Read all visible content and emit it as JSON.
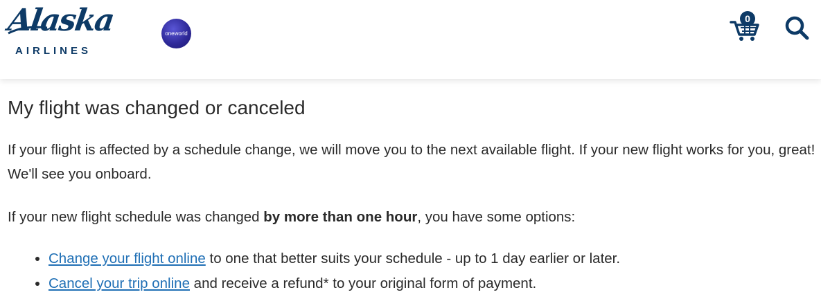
{
  "header": {
    "logo_text": "Alaska",
    "logo_subtext": "AIRLINES",
    "alliance_badge": "oneworld",
    "cart_count": "0",
    "brand_color": "#0d3a66"
  },
  "main": {
    "title": "My flight was changed or canceled",
    "paragraph_1": "If your flight is affected by a schedule change, we will move you to the next available flight. If your new flight works for you, great! We'll see you onboard.",
    "paragraph_2_before": "If your new flight schedule was changed ",
    "paragraph_2_bold": "by more than one hour",
    "paragraph_2_after": ", you have some options:",
    "options": [
      {
        "link": "Change your flight online",
        "text": " to one that better suits your schedule - up to 1 day earlier or later."
      },
      {
        "link": "Cancel your trip online",
        "text": " and receive a refund* to your original form of payment."
      }
    ],
    "link_color": "#1f6fb5"
  }
}
